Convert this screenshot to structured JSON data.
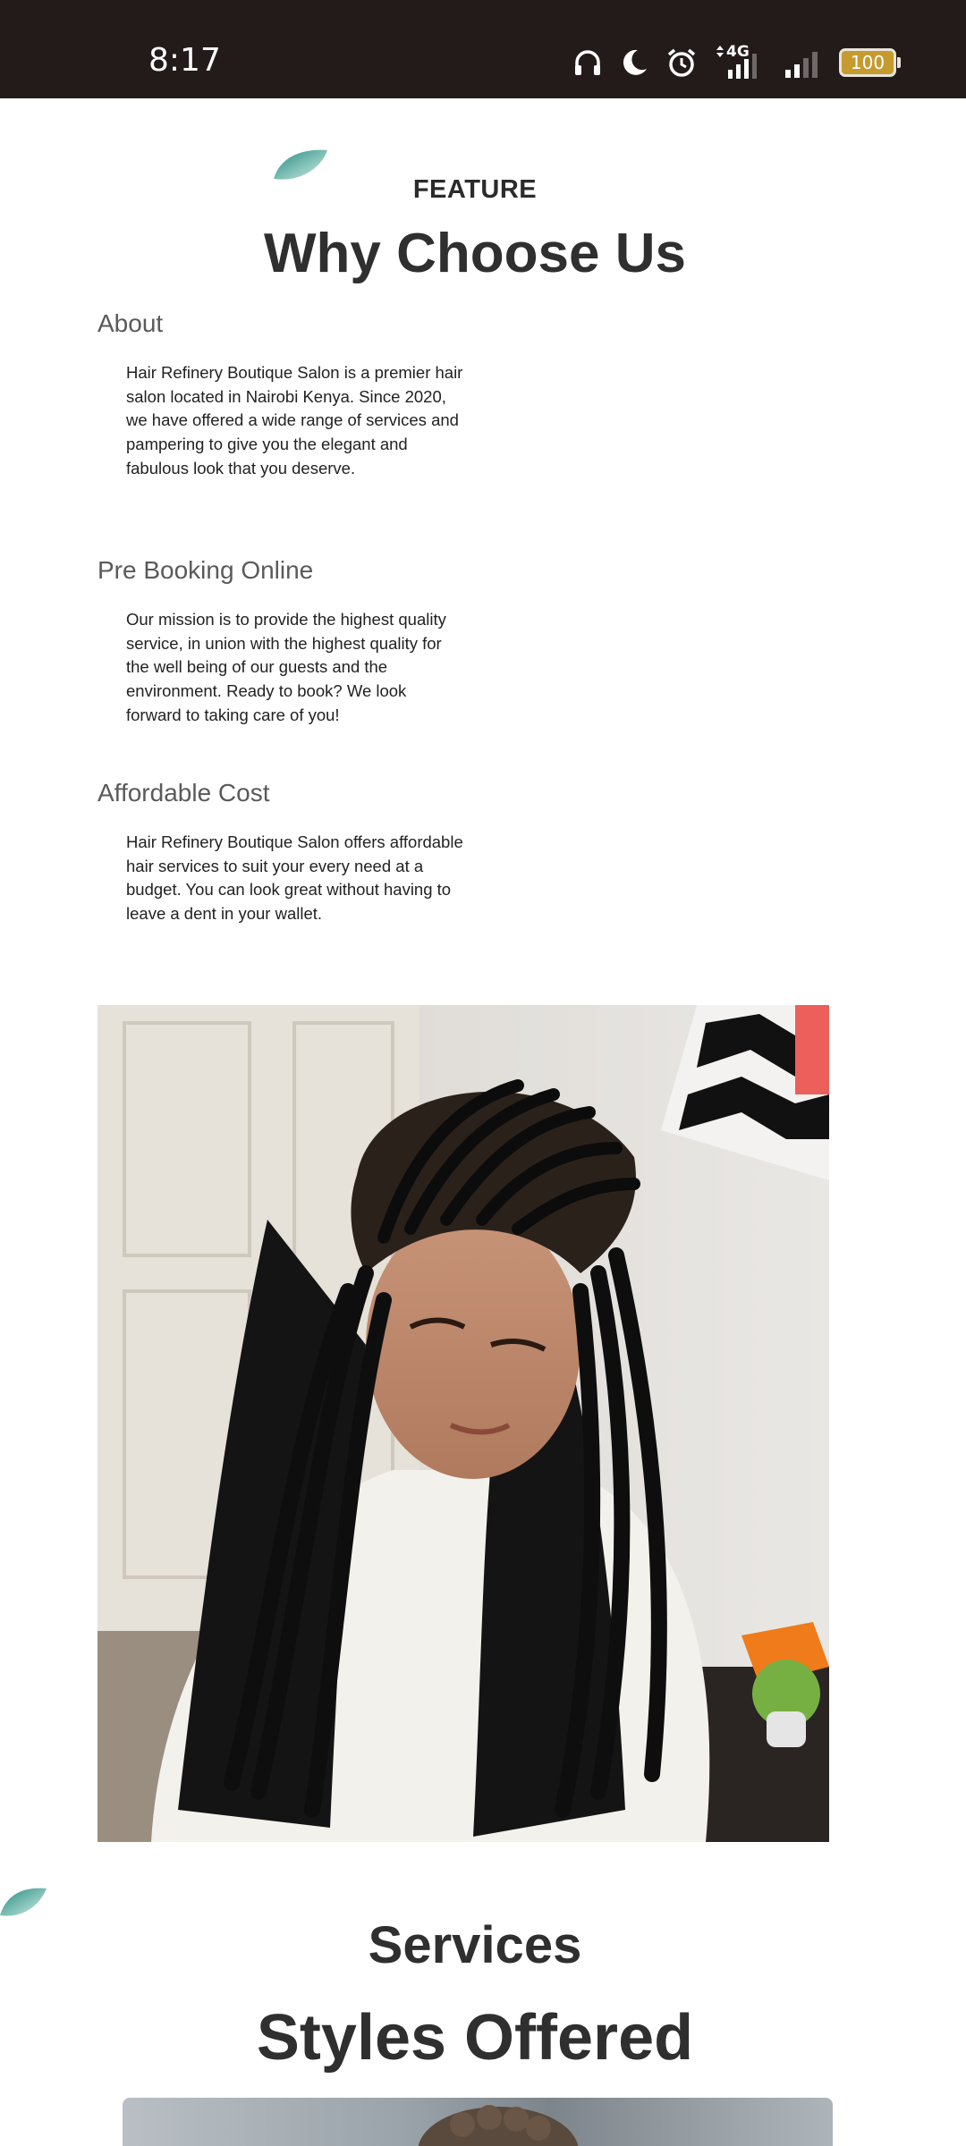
{
  "status_bar": {
    "time": "8:17",
    "network": "4G",
    "battery": "100",
    "icons": [
      "headphones-icon",
      "moon-icon",
      "alarm-icon",
      "signal-4g-icon",
      "signal-icon",
      "battery-icon"
    ]
  },
  "feature": {
    "kicker": "FEATURE",
    "title": "Why Choose Us",
    "sections": [
      {
        "heading": "About",
        "text": "Hair Refinery Boutique Salon is a premier hair salon located in Nairobi Kenya. Since 2020, we have offered a wide range of services and pampering to give you the elegant and fabulous look that you deserve."
      },
      {
        "heading": "Pre Booking Online",
        "text": "Our mission is to provide the highest quality service, in union with the highest quality for the well being of our guests and the environment. Ready to book? We look forward to taking care of you!"
      },
      {
        "heading": "Affordable Cost",
        "text": "Hair Refinery Boutique Salon offers affordable hair services to suit your every need at a budget. You can look great without having to leave a dent in your wallet."
      }
    ]
  },
  "services": {
    "kicker": "Services",
    "title": "Styles Offered"
  },
  "colors": {
    "status_bar_bg": "#231a1a",
    "accent_leaf": "#2a9d8f",
    "text_dark": "#2f2f2f",
    "battery_fill": "#c59a2f"
  }
}
